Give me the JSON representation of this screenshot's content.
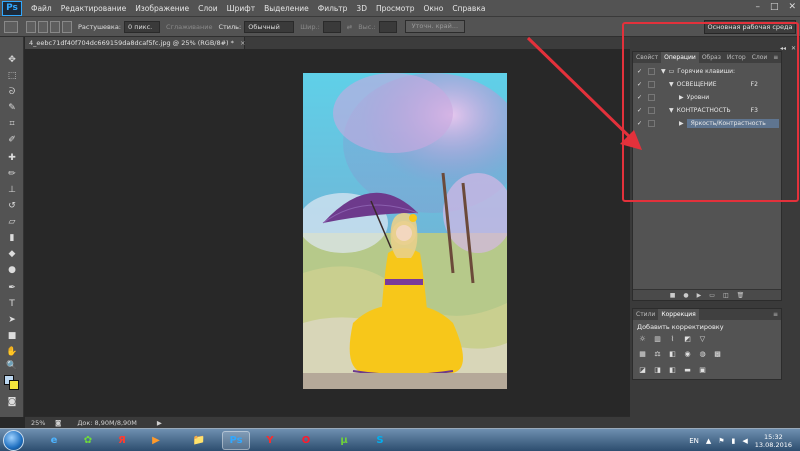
{
  "app": {
    "logo": "Ps",
    "menu": [
      "Файл",
      "Редактирование",
      "Изображение",
      "Слои",
      "Шрифт",
      "Выделение",
      "Фильтр",
      "3D",
      "Просмотр",
      "Окно",
      "Справка"
    ]
  },
  "options_bar": {
    "feather_label": "Растушевка:",
    "feather_value": "0 пикс.",
    "antialias_label": "Сглаживание",
    "style_label": "Стиль:",
    "style_value": "Обычный",
    "width_label": "Шир.:",
    "height_label": "Выс.:",
    "refine_button": "Уточн. край...",
    "workspace": "Основная рабочая среда"
  },
  "document": {
    "tab_title": "4_eebc71df40f704dc669159da8dcaf5fc.jpg @ 25% (RGB/8#) *",
    "tab_close": "×"
  },
  "status": {
    "zoom": "25%",
    "doc_size": "Док: 8,90M/8,90M"
  },
  "actions_panel": {
    "tabs": [
      "Свойст",
      "Операции",
      "Образ",
      "Истор",
      "Слои"
    ],
    "active_tab": "Операции",
    "rows": [
      {
        "check": "✓",
        "arrow": "▼",
        "label": "Горячие клавиши:",
        "key": "",
        "indent": 0,
        "folder": true
      },
      {
        "check": "✓",
        "arrow": "▼",
        "label": "ОСВЕЩЕНИЕ",
        "key": "F2",
        "indent": 1,
        "folder": false
      },
      {
        "check": "✓",
        "arrow": "▶",
        "label": "Уровни",
        "key": "",
        "indent": 2,
        "folder": false
      },
      {
        "check": "✓",
        "arrow": "▼",
        "label": "КОНТРАСТНОСТЬ",
        "key": "F3",
        "indent": 1,
        "folder": false
      },
      {
        "check": "✓",
        "arrow": "▶",
        "label": "Яркость/Контрастность",
        "key": "",
        "indent": 2,
        "folder": false,
        "selected": true
      }
    ]
  },
  "adjustments_panel": {
    "tabs": [
      "Стили",
      "Коррекция"
    ],
    "active_tab": "Коррекция",
    "title": "Добавить корректировку"
  },
  "taskbar": {
    "lang": "EN",
    "time": "15:32",
    "date": "13.08.2016",
    "apps": [
      "e",
      "✿",
      "Я",
      "▶",
      "📁",
      "Ps",
      "Y",
      "O",
      "µ",
      "S"
    ]
  },
  "colors": {
    "highlight_red": "#e3313b",
    "selection": "#5f7590",
    "foreground": "#bcd7f0",
    "background": "#f3e43c"
  }
}
